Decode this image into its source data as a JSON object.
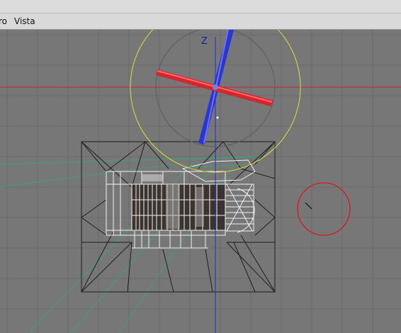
{
  "menubar": {
    "items": [
      {
        "label": "ro"
      },
      {
        "label": "Vista"
      }
    ]
  },
  "viewport": {
    "axis_label": "Z",
    "colors": {
      "background": "#777777",
      "grid": "#6b6b6b",
      "horizontal_axis": "#c0262b",
      "vertical_axis": "#1f2cc8",
      "gizmo_ring": "#e2dc3a",
      "selection_ring": "#d9181c",
      "camera_wire": "#1e1e1e",
      "guide_lines": "#3aa57a",
      "model": "#f2f2f2"
    }
  }
}
